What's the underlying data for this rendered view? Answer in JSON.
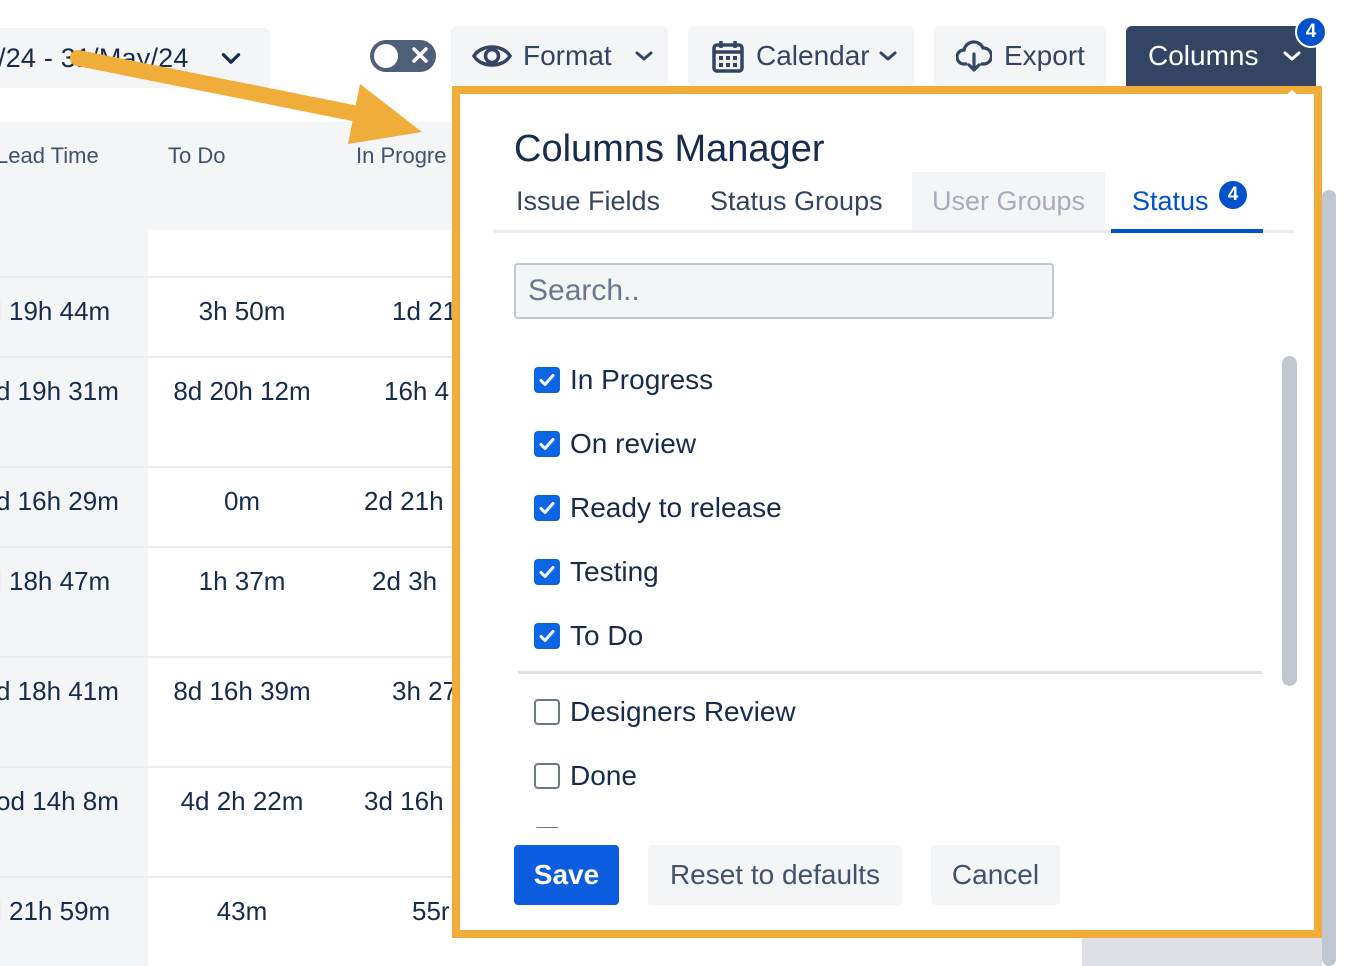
{
  "toolbar": {
    "date_range": "/24 - 31/May/24",
    "format_label": "Format",
    "calendar_label": "Calendar",
    "export_label": "Export",
    "columns_label": "Columns",
    "columns_badge": "4"
  },
  "table": {
    "headers": [
      "Lead Time",
      "To Do",
      "In Progre"
    ],
    "rows": [
      [
        "l 19h 44m",
        "3h 50m",
        "1d 21"
      ],
      [
        "d 19h 31m",
        "8d 20h 12m",
        "16h 4"
      ],
      [
        "d 16h 29m",
        "0m",
        "2d 21h"
      ],
      [
        "l 18h 47m",
        "1h 37m",
        "2d 3h"
      ],
      [
        "d 18h 41m",
        "8d 16h 39m",
        "3h 27"
      ],
      [
        "od 14h 8m",
        "4d 2h 22m",
        "3d 16h"
      ],
      [
        "l 21h 59m",
        "43m",
        "55r"
      ]
    ]
  },
  "columns_manager": {
    "title": "Columns Manager",
    "tabs": [
      {
        "label": "Issue Fields"
      },
      {
        "label": "Status Groups"
      },
      {
        "label": "User Groups"
      },
      {
        "label": "Status"
      }
    ],
    "status_badge": "4",
    "search_placeholder": "Search..",
    "checked": [
      "In Progress",
      "On review",
      "Ready to release",
      "Testing",
      "To Do"
    ],
    "unchecked": [
      "Designers Review",
      "Done"
    ],
    "save_label": "Save",
    "reset_label": "Reset to defaults",
    "cancel_label": "Cancel"
  },
  "colors": {
    "accent": "#0052cc",
    "highlight_border": "#f0ad3a",
    "columns_button": "#344563"
  }
}
